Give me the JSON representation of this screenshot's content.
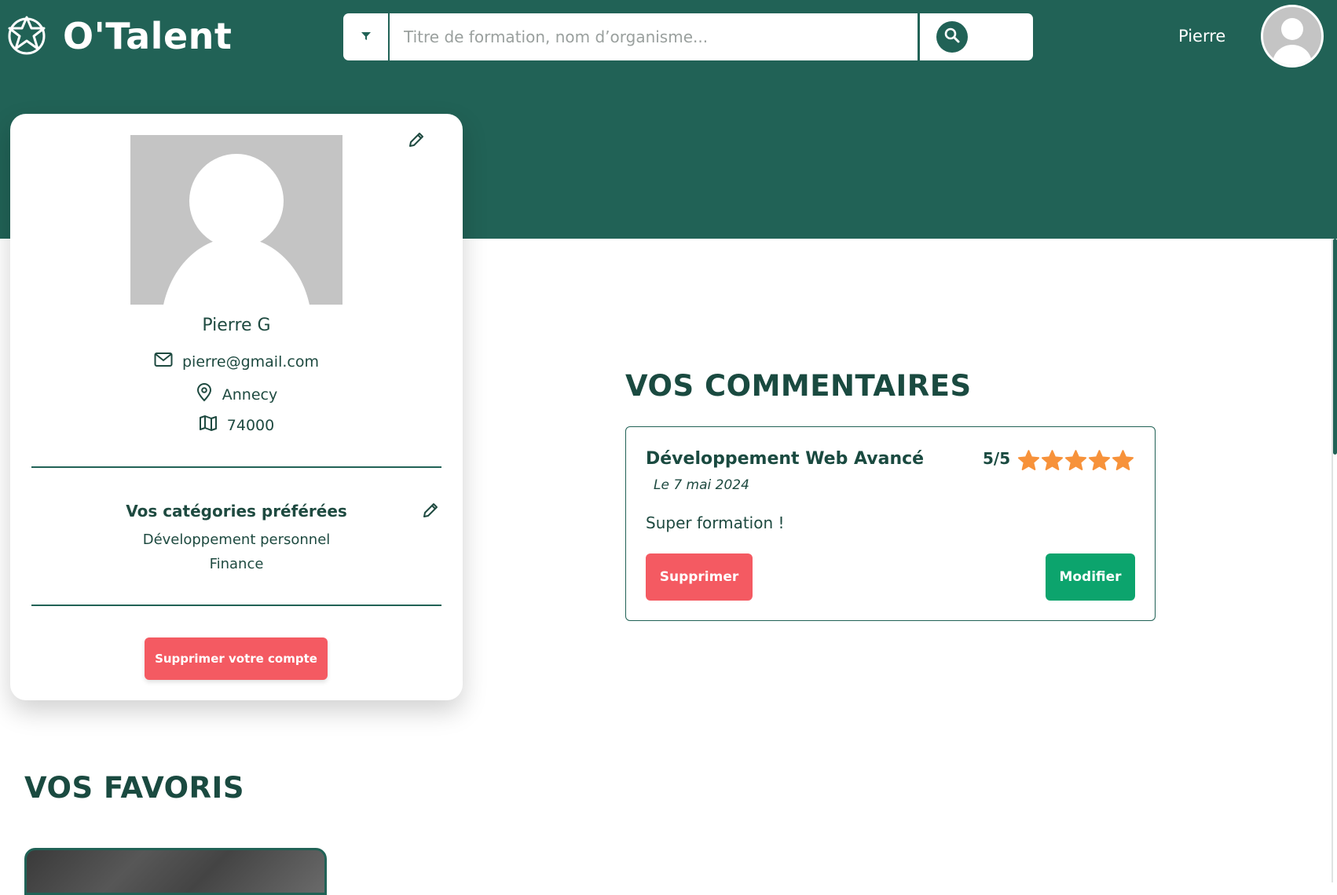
{
  "header": {
    "brand": "O'Talent",
    "search_placeholder": "Titre de formation, nom d’organisme...",
    "user_name": "Pierre",
    "icons": {
      "logo": "star-logo-icon",
      "filter": "filter-funnel-icon",
      "search": "search-icon",
      "avatar": "user-avatar-icon"
    }
  },
  "profile": {
    "name": "Pierre G",
    "email": "pierre@gmail.com",
    "city": "Annecy",
    "postal_code": "74000",
    "preferences_title": "Vos catégories préférées",
    "preferences": [
      "Développement personnel",
      "Finance"
    ],
    "delete_account_label": "Supprimer votre compte",
    "icons": {
      "email": "mail-icon",
      "city": "location-pin-icon",
      "postal_code": "map-icon",
      "edit": "pencil-icon"
    }
  },
  "comments": {
    "section_title": "VOS COMMENTAIRES",
    "items": [
      {
        "title": "Développement Web Avancé",
        "rating_text": "5/5",
        "rating": 5,
        "date": "Le 7 mai 2024",
        "text": "Super formation !",
        "delete_label": "Supprimer",
        "edit_label": "Modifier"
      }
    ]
  },
  "favorites": {
    "section_title": "VOS FAVORIS"
  },
  "colors": {
    "primary": "#216256",
    "danger": "#f45a62",
    "success": "#0ca46d",
    "star": "#f7923a",
    "avatar_placeholder": "#c4c4c4"
  }
}
